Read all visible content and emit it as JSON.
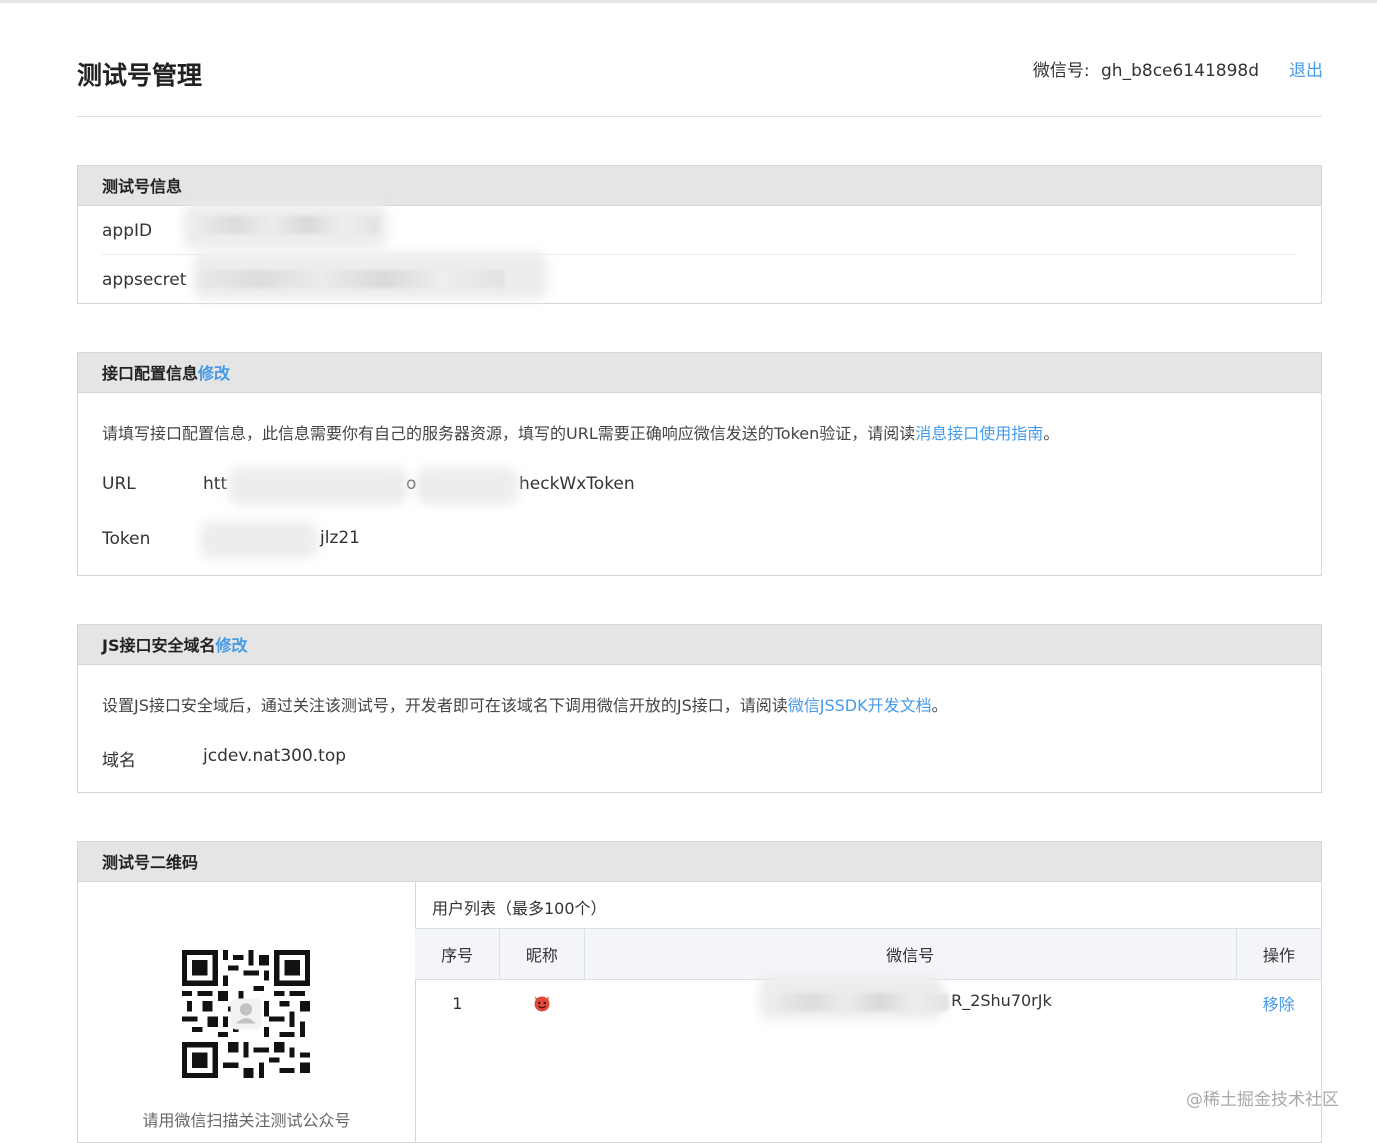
{
  "header": {
    "title": "测试号管理",
    "account_label": "微信号:",
    "account_value": "gh_b8ce6141898d",
    "logout": "退出"
  },
  "test_account_info": {
    "title": "测试号信息",
    "appid_label": "appID",
    "appsecret_label": "appsecret"
  },
  "interface_config": {
    "title": "接口配置信息",
    "edit": "修改",
    "desc_prefix": "请填写接口配置信息，此信息需要你有自己的服务器资源，填写的URL需要正确响应微信发送的Token验证，请阅读",
    "desc_link": "消息接口使用指南",
    "desc_suffix": "。",
    "url_label": "URL",
    "url_value_start": "htt",
    "url_value_mid": "o",
    "url_value_end": "heckWxToken",
    "token_label": "Token",
    "token_value_end": "jlz21"
  },
  "js_domain": {
    "title": "JS接口安全域名",
    "edit": "修改",
    "desc_prefix": "设置JS接口安全域后，通过关注该测试号，开发者即可在该域名下调用微信开放的JS接口，请阅读",
    "desc_link": "微信JSSDK开发文档",
    "desc_suffix": "。",
    "domain_label": "域名",
    "domain_value": "jcdev.nat300.top"
  },
  "qrcode": {
    "title": "测试号二维码",
    "caption": "请用微信扫描关注测试公众号"
  },
  "user_list": {
    "title": "用户列表（最多100个）",
    "columns": [
      "序号",
      "昵称",
      "微信号",
      "操作"
    ],
    "rows": [
      {
        "index": "1",
        "nickname_icon": "devil-face-icon",
        "wechat_id_suffix": "R_2Shu70rJk",
        "action": "移除"
      }
    ]
  },
  "watermark": "@稀土掘金技术社区",
  "colors": {
    "link": "#459ae9",
    "panel_header": "#e5e5e5",
    "border": "#d6d6d6"
  }
}
